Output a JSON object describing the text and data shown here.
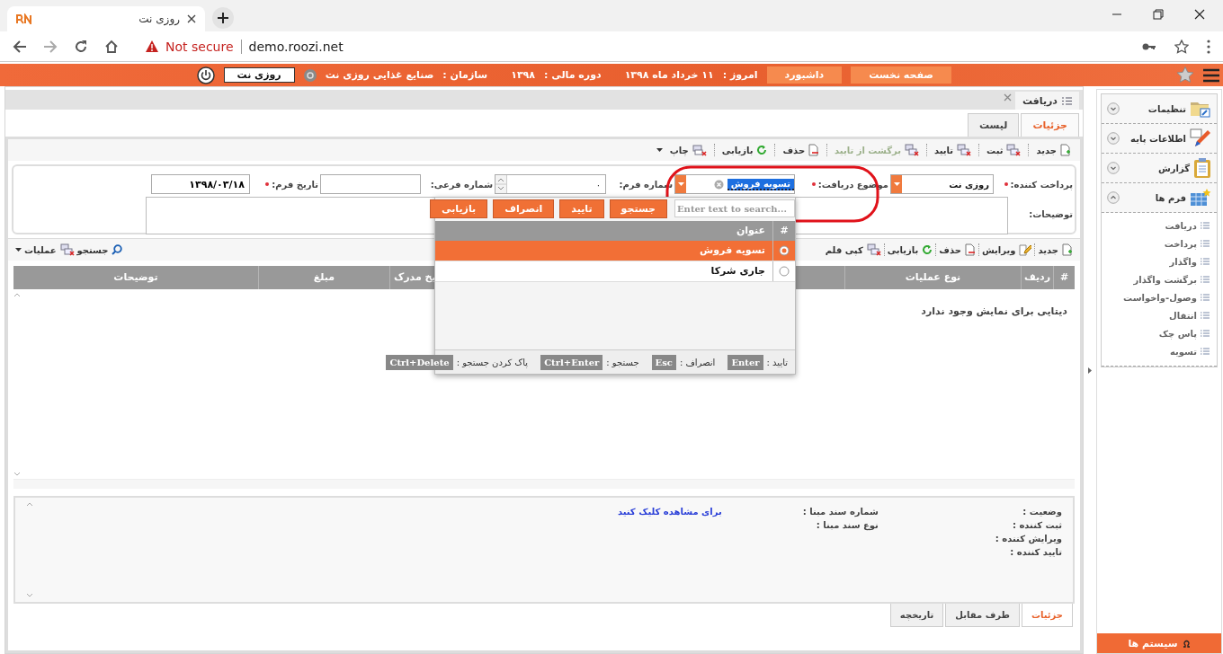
{
  "browser": {
    "tab_title": "روزی نت",
    "security_label": "Not secure",
    "url": "demo.roozi.net"
  },
  "header": {
    "nav_buttons": [
      "صفحه نخست",
      "داشبورد"
    ],
    "today_label": "امروز :",
    "today": "۱۱ خرداد ماه ۱۳۹۸",
    "fiscal_label": "دوره مالی :",
    "fiscal_year": "۱۳۹۸",
    "organization_label": "سازمان :",
    "organization": "صنایع غذایی روزی نت",
    "user_name": "روزی نت"
  },
  "page_tab": {
    "title": "دریافت"
  },
  "view_tabs": [
    {
      "label": "جزئیات",
      "selected": true
    },
    {
      "label": "لیست",
      "selected": false
    }
  ],
  "toolbar": [
    {
      "label": "جدید",
      "disabled": false
    },
    {
      "label": "ثبت",
      "disabled": false
    },
    {
      "label": "تایید",
      "disabled": false
    },
    {
      "label": "برگشت از تایید",
      "disabled": true
    },
    {
      "label": "حذف",
      "disabled": false
    },
    {
      "label": "بازیابی",
      "disabled": false
    },
    {
      "label": "چاپ",
      "disabled": false
    }
  ],
  "form": {
    "payer": {
      "label": "پرداخت کننده:",
      "required": true,
      "value": "روزی نت"
    },
    "subject": {
      "label": "موضوع دریافت:",
      "required": true,
      "value": "تسویه فروش",
      "search_placeholder": "Enter text to search..."
    },
    "form_number": {
      "label": "شماره فرم:",
      "required": false,
      "value": "۰"
    },
    "sub_number": {
      "label": "شماره فرعی:",
      "required": false
    },
    "form_date": {
      "label": "تاریخ فرم:",
      "required": true,
      "value": "۱۳۹۸/۰۳/۱۸"
    },
    "description": {
      "label": "توضیحات:"
    }
  },
  "dropdown": {
    "buttons": [
      "جستجو",
      "تایید",
      "انصراف",
      "بازیابی"
    ],
    "columns": [
      "#",
      "عنوان"
    ],
    "rows": [
      {
        "title": "تسویه فروش",
        "selected": true
      },
      {
        "title": "جاری شرکا",
        "selected": false
      }
    ],
    "shortcuts": [
      {
        "label": "تایید :",
        "key": "Enter"
      },
      {
        "label": "انصراف :",
        "key": "Esc"
      },
      {
        "label": "جستجو :",
        "key": "Ctrl+Enter"
      },
      {
        "label": "پاک کردن جستجو :",
        "key": "Ctrl+Delete"
      }
    ]
  },
  "grid_toolbar": {
    "items": [
      "جدید",
      "ویرایش",
      "حذف",
      "بازیابی",
      "کپی قلم"
    ],
    "end_items": [
      "جستجو",
      "عملیات"
    ]
  },
  "grid": {
    "columns": [
      "#",
      "ردیف",
      "نوع عملیات",
      "یخ مدرک",
      "مبلغ",
      "توضیحات"
    ],
    "empty_message": "دیتایی برای نمایش وجود ندارد"
  },
  "details": {
    "fields": [
      "وضعیت :",
      "ثبت کننده :",
      "ویرایش کننده :",
      "تایید کننده :"
    ],
    "reference_fields": [
      {
        "label": "شماره سند مبنا :",
        "link": "برای مشاهده کلیک کنید"
      },
      {
        "label": "نوع سند مبنا :"
      }
    ]
  },
  "bottom_tabs": [
    {
      "label": "جزئیات",
      "selected": true
    },
    {
      "label": "طرف مقابل",
      "selected": false
    },
    {
      "label": "تاریخچه",
      "selected": false
    }
  ],
  "sidebar": {
    "sections": [
      {
        "label": "تنظیمات",
        "expanded": false
      },
      {
        "label": "اطلاعات پایه",
        "expanded": false
      },
      {
        "label": "گزارش",
        "expanded": false
      },
      {
        "label": "فرم ها",
        "expanded": true,
        "children": [
          "دریافت",
          "پرداخت",
          "واگذار",
          "برگشت واگذار",
          "وصول-واخواست",
          "انتقال",
          "پاس چک",
          "تسویه"
        ]
      }
    ],
    "footer_button": "سیستم ها"
  }
}
